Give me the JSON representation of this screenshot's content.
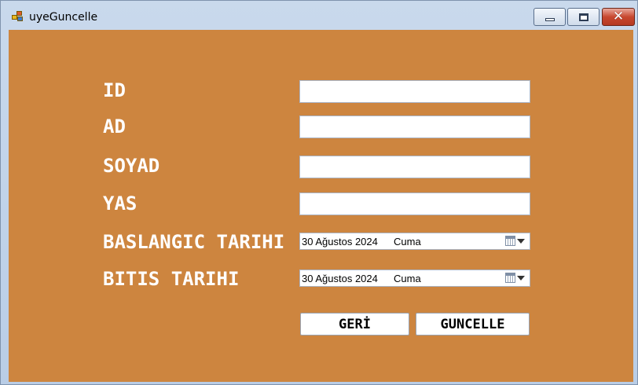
{
  "window": {
    "title": "uyeGuncelle",
    "icons": {
      "app": "app-form-icon",
      "minimize": "minimize-icon",
      "maximize": "maximize-icon",
      "close": "close-icon"
    },
    "colors": {
      "client_background": "#cd853f",
      "label_text": "#ffffff",
      "close_button": "#c8482f"
    }
  },
  "form": {
    "labels": {
      "id": "ID",
      "ad": "AD",
      "soyad": "SOYAD",
      "yas": "YAS",
      "baslangic": "BASLANGIC TARIHI",
      "bitis": "BITIS TARIHI"
    },
    "inputs": {
      "id": "",
      "ad": "",
      "soyad": "",
      "yas": ""
    },
    "dates": {
      "baslangic": {
        "date": "30 Ağustos 2024",
        "day": "Cuma",
        "icon": "calendar-dropdown-icon"
      },
      "bitis": {
        "date": "30 Ağustos 2024",
        "day": "Cuma",
        "icon": "calendar-dropdown-icon"
      }
    },
    "buttons": {
      "geri": "GERİ",
      "guncelle": "GUNCELLE"
    }
  }
}
